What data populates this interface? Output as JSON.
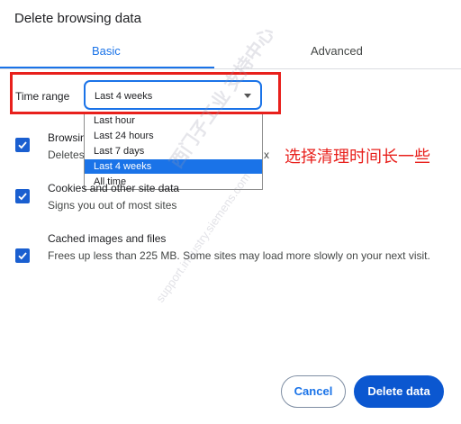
{
  "dialog": {
    "title": "Delete browsing data"
  },
  "tabs": [
    {
      "label": "Basic",
      "active": true
    },
    {
      "label": "Advanced",
      "active": false
    }
  ],
  "time_range": {
    "label": "Time range",
    "selected": "Last 4 weeks",
    "options": [
      "Last hour",
      "Last 24 hours",
      "Last 7 days",
      "Last 4 weeks",
      "All time"
    ],
    "selected_index": 3
  },
  "options": [
    {
      "title": "Browsing history",
      "desc": "Deletes history and autocomplete in search box",
      "checked": true
    },
    {
      "title": "Cookies and other site data",
      "desc": "Signs you out of most sites",
      "checked": true
    },
    {
      "title": "Cached images and files",
      "desc": "Frees up less than 225 MB. Some sites may load more slowly on your next visit.",
      "checked": true
    }
  ],
  "annotation": "选择清理时间长一些",
  "watermark": {
    "text": "西门子工业 支持中心",
    "url": "support.industry.siemens.com"
  },
  "buttons": {
    "cancel": "Cancel",
    "delete": "Delete data"
  },
  "colors": {
    "accent": "#1a73e8",
    "annotation": "#e8201c",
    "primary_button": "#0b57d0"
  }
}
